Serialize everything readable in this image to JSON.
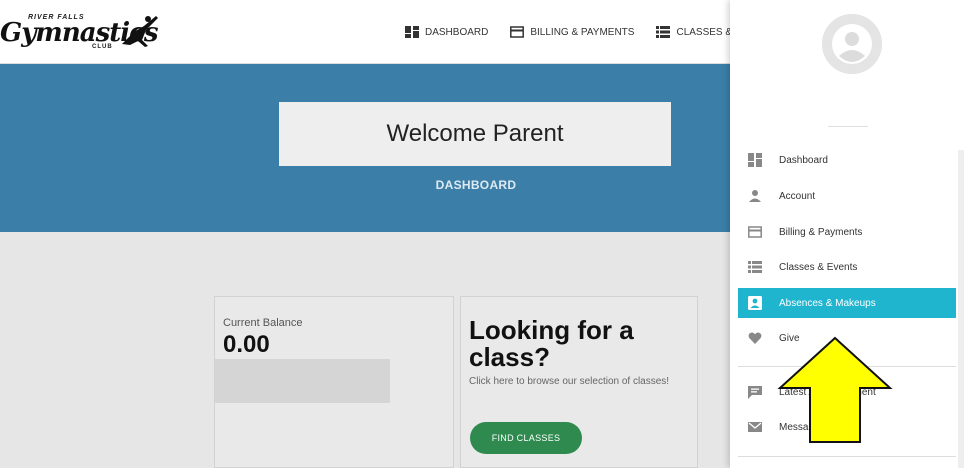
{
  "header": {
    "logo_small": "RIVER FALLS",
    "logo_main": "Gymnastics",
    "logo_club": "CLUB",
    "nav": [
      {
        "label": "DASHBOARD",
        "icon": "dashboard-icon"
      },
      {
        "label": "BILLING & PAYMENTS",
        "icon": "credit-card-icon"
      },
      {
        "label": "CLASSES & EVE",
        "icon": "list-icon"
      }
    ]
  },
  "hero": {
    "welcome": "Welcome Parent",
    "page_label": "DASHBOARD",
    "background": "#3b7fa9"
  },
  "balance_card": {
    "label": "Current Balance",
    "value": "0.00"
  },
  "class_card": {
    "title": "Looking for a class?",
    "description": "Click here to browse our selection of classes!",
    "button": "FIND CLASSES",
    "button_color": "#2e8a4f"
  },
  "side_menu": {
    "items": [
      {
        "label": "Dashboard",
        "icon": "dashboard-icon",
        "active": false
      },
      {
        "label": "Account",
        "icon": "person-icon",
        "active": false
      },
      {
        "label": "Billing & Payments",
        "icon": "credit-card-icon",
        "active": false
      },
      {
        "label": "Classes & Events",
        "icon": "list-icon",
        "active": false
      },
      {
        "label": "Absences & Makeups",
        "icon": "badge-icon",
        "active": true
      },
      {
        "label": "Give",
        "icon": "heart-icon",
        "active": false
      },
      {
        "label": "Latest Announcement",
        "icon": "chat-icon",
        "active": false
      },
      {
        "label": "Messages",
        "icon": "mail-icon",
        "active": false
      }
    ],
    "active_color": "#1fb5cf"
  },
  "annotation": {
    "arrow_color": "#ffff00",
    "arrow_direction": "up"
  }
}
